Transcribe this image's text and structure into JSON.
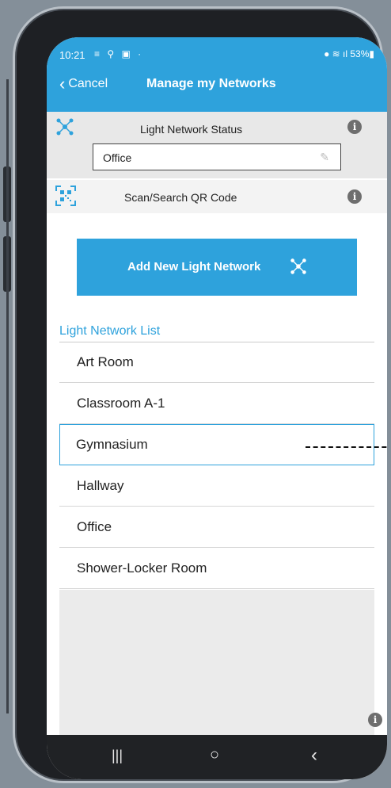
{
  "status_bar": {
    "time": "10:21",
    "notifications": "≡ ⚲ ▣ ·",
    "right_icons": "● ≋ ıl 53%▮"
  },
  "nav": {
    "cancel_label": "Cancel",
    "title": "Manage my Networks"
  },
  "status_section": {
    "label": "Light Network Status",
    "network_value": "Office",
    "icon": "network-nodes-icon",
    "info_icon": "info-icon"
  },
  "qr_section": {
    "label": "Scan/Search QR Code",
    "icon": "qr-code-icon",
    "info_icon": "info-icon"
  },
  "add_button": {
    "label": "Add New Light Network",
    "icon": "network-nodes-icon"
  },
  "list": {
    "header": "Light Network List",
    "items": [
      {
        "label": "Art Room",
        "selected": false
      },
      {
        "label": "Classroom A-1",
        "selected": false
      },
      {
        "label": "Gymnasium",
        "selected": true
      },
      {
        "label": "Hallway",
        "selected": false
      },
      {
        "label": "Office",
        "selected": false
      },
      {
        "label": "Shower-Locker Room",
        "selected": false
      }
    ]
  },
  "system_nav": {
    "recents": "|||",
    "home": "○",
    "back": "‹"
  },
  "colors": {
    "accent": "#2ea2dc",
    "background": "#848f99",
    "grey_section": "#e8e8e8"
  }
}
